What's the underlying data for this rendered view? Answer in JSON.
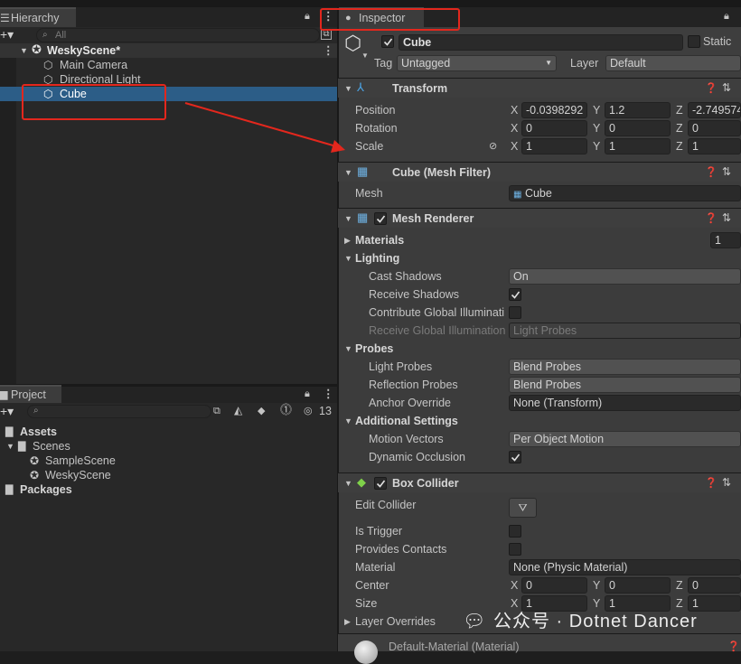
{
  "hierarchy": {
    "tab": "Hierarchy",
    "search_placeholder": "All",
    "scene": "WeskyScene*",
    "items": [
      "Main Camera",
      "Directional Light",
      "Cube"
    ]
  },
  "project": {
    "tab": "Project",
    "hidden_count": "13",
    "tree": [
      {
        "label": "Assets"
      },
      {
        "label": "Scenes"
      },
      {
        "label": "SampleScene"
      },
      {
        "label": "WeskyScene"
      },
      {
        "label": "Packages"
      }
    ]
  },
  "inspector": {
    "tab": "Inspector",
    "object_name": "Cube",
    "static_label": "Static",
    "tag_label": "Tag",
    "tag_value": "Untagged",
    "layer_label": "Layer",
    "layer_value": "Default",
    "transform": {
      "title": "Transform",
      "position_label": "Position",
      "rotation_label": "Rotation",
      "scale_label": "Scale",
      "position": [
        "-0.0398292",
        "1.2",
        "-2.749574"
      ],
      "rotation": [
        "0",
        "0",
        "0"
      ],
      "scale": [
        "1",
        "1",
        "1"
      ]
    },
    "mesh_filter": {
      "title": "Cube (Mesh Filter)",
      "mesh_label": "Mesh",
      "mesh_value": "Cube"
    },
    "mesh_renderer": {
      "title": "Mesh Renderer",
      "materials": "Materials",
      "materials_count": "1",
      "lighting": "Lighting",
      "cast_shadows": "Cast Shadows",
      "cast_shadows_value": "On",
      "receive_shadows": "Receive Shadows",
      "contribute_gi": "Contribute Global Illuminati",
      "receive_gi": "Receive Global Illumination",
      "receive_gi_value": "Light Probes",
      "probes": "Probes",
      "light_probes": "Light Probes",
      "light_probes_value": "Blend Probes",
      "reflection_probes": "Reflection Probes",
      "reflection_probes_value": "Blend Probes",
      "anchor_override": "Anchor Override",
      "anchor_override_value": "None (Transform)",
      "additional": "Additional Settings",
      "motion_vectors": "Motion Vectors",
      "motion_vectors_value": "Per Object Motion",
      "dynamic_occlusion": "Dynamic Occlusion"
    },
    "box_collider": {
      "title": "Box Collider",
      "edit_collider": "Edit Collider",
      "is_trigger": "Is Trigger",
      "provides_contacts": "Provides Contacts",
      "material": "Material",
      "material_value": "None (Physic Material)",
      "center": "Center",
      "center_values": [
        "0",
        "0",
        "0"
      ],
      "size": "Size",
      "size_values": [
        "1",
        "1",
        "1"
      ],
      "layer_overrides": "Layer Overrides"
    },
    "default_material": "Default-Material (Material)"
  },
  "axes": [
    "X",
    "Y",
    "Z"
  ],
  "watermark": "公众号 · Dotnet Dancer",
  "colors": {
    "selection": "#2c5d87",
    "annotation": "#e3271d"
  }
}
